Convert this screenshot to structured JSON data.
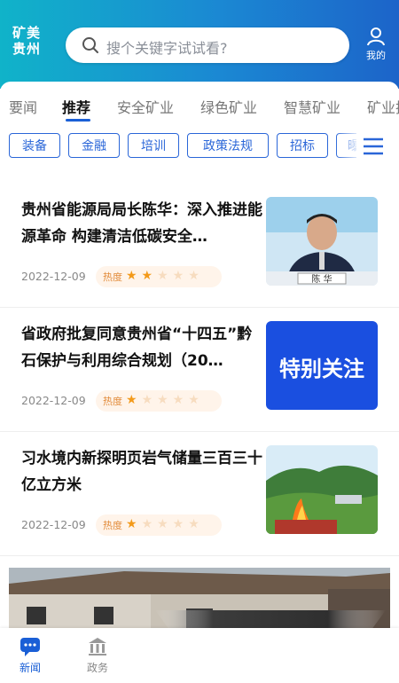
{
  "header": {
    "logo_line1": "矿美",
    "logo_line2": "贵州",
    "search_placeholder": "搜个关键字试试看?",
    "me_label": "我的"
  },
  "tabs": [
    {
      "label": "要闻"
    },
    {
      "label": "推荐"
    },
    {
      "label": "安全矿业"
    },
    {
      "label": "绿色矿业"
    },
    {
      "label": "智慧矿业"
    },
    {
      "label": "矿业技"
    }
  ],
  "chips": [
    {
      "label": "装备"
    },
    {
      "label": "金融"
    },
    {
      "label": "培训"
    },
    {
      "label": "政策法规"
    },
    {
      "label": "招标"
    },
    {
      "label": "曝"
    }
  ],
  "articles": [
    {
      "title": "贵州省能源局局长陈华：深入推进能源革命 构建清洁低碳安全…",
      "date": "2022-12-09",
      "hot_label": "热度",
      "rating": 2,
      "thumb_caption": "陈 华"
    },
    {
      "title": "省政府批复同意贵州省“十四五”黔石保护与利用综合规划（20…",
      "date": "2022-12-09",
      "hot_label": "热度",
      "rating": 1,
      "thumb_caption": "特别关注"
    },
    {
      "title": "习水境内新探明页岩气储量三百三十亿立方米",
      "date": "2022-12-09",
      "hot_label": "热度",
      "rating": 1,
      "thumb_caption": ""
    }
  ],
  "bottom_nav": [
    {
      "label": "新闻",
      "icon": "news-icon"
    },
    {
      "label": "政务",
      "icon": "government-icon"
    }
  ],
  "colors": {
    "accent": "#1a5fd6",
    "star_on": "#f39a1a",
    "star_off": "#f7dcbf"
  }
}
